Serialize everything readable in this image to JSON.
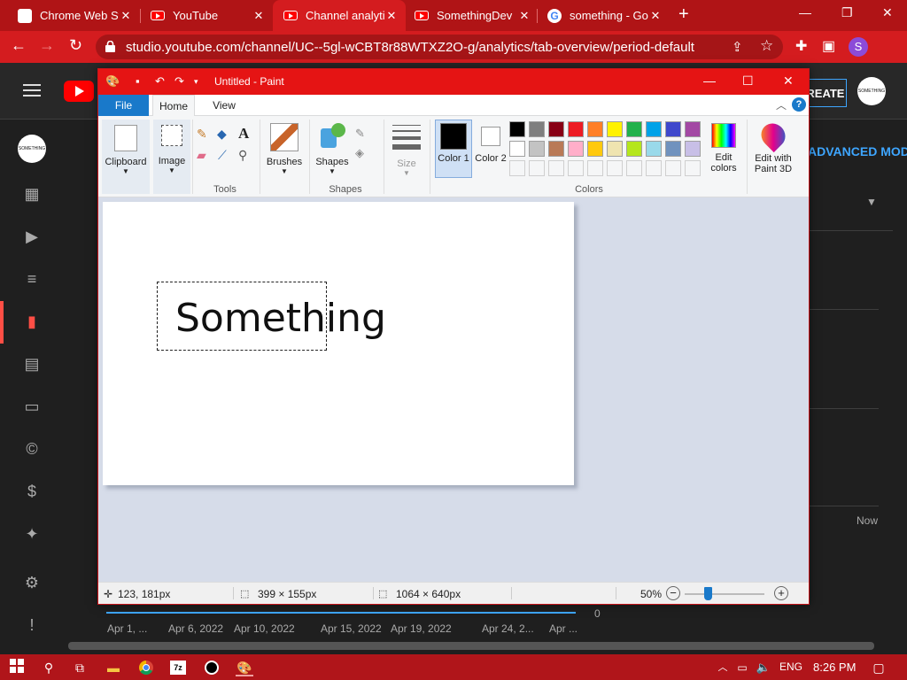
{
  "browser": {
    "tabs": [
      {
        "label": "Chrome Web Store",
        "icon": "chrome-web-store-icon",
        "active": false
      },
      {
        "label": "YouTube",
        "icon": "youtube-icon",
        "active": false
      },
      {
        "label": "Channel analytics",
        "icon": "youtube-icon",
        "active": true
      },
      {
        "label": "SomethingDev",
        "icon": "youtube-icon",
        "active": false
      },
      {
        "label": "something - Go",
        "icon": "google-icon",
        "active": false
      }
    ],
    "url": "studio.youtube.com/channel/UC--5gl-wCBT8r88WTXZ2O-g/analytics/tab-overview/period-default",
    "profile_initial": "S"
  },
  "yt": {
    "channel_avatar_text": "SOMETHING",
    "create_label": "CREATE",
    "advanced_mode": "ADVANCED MODE",
    "now_label": "Now",
    "axis_zero": "0",
    "x_ticks": [
      "Apr 1, ...",
      "Apr 6, 2022",
      "Apr 10, 2022",
      "Apr 15, 2022",
      "Apr 19, 2022",
      "Apr 24, 2...",
      "Apr ..."
    ]
  },
  "paint": {
    "title": "Untitled - Paint",
    "tabs": {
      "file": "File",
      "home": "Home",
      "view": "View"
    },
    "ribbon": {
      "clipboard": "Clipboard",
      "image": "Image",
      "tools_group": "Tools",
      "brushes": "Brushes",
      "shapes": "Shapes",
      "shapes_group": "Shapes",
      "size": "Size",
      "color1": "Color 1",
      "color2": "Color 2",
      "colors_group": "Colors",
      "edit_colors": "Edit colors",
      "edit_paint3d": "Edit with Paint 3D"
    },
    "palette_row1": [
      "#000000",
      "#7f7f7f",
      "#880015",
      "#ed1c24",
      "#ff7f27",
      "#fff200",
      "#22b14c",
      "#00a2e8",
      "#3f48cc",
      "#a349a4"
    ],
    "palette_row2": [
      "#ffffff",
      "#c3c3c3",
      "#b97a57",
      "#ffaec9",
      "#ffc90e",
      "#efe4b0",
      "#b5e61d",
      "#99d9ea",
      "#7092be",
      "#c8bfe7"
    ],
    "canvas_text": "Something",
    "status": {
      "cursor": "123, 181px",
      "selection": "399 × 155px",
      "image_size": "1064 × 640px",
      "zoom": "50%"
    }
  },
  "taskbar": {
    "lang": "ENG",
    "time": "8:26 PM"
  }
}
